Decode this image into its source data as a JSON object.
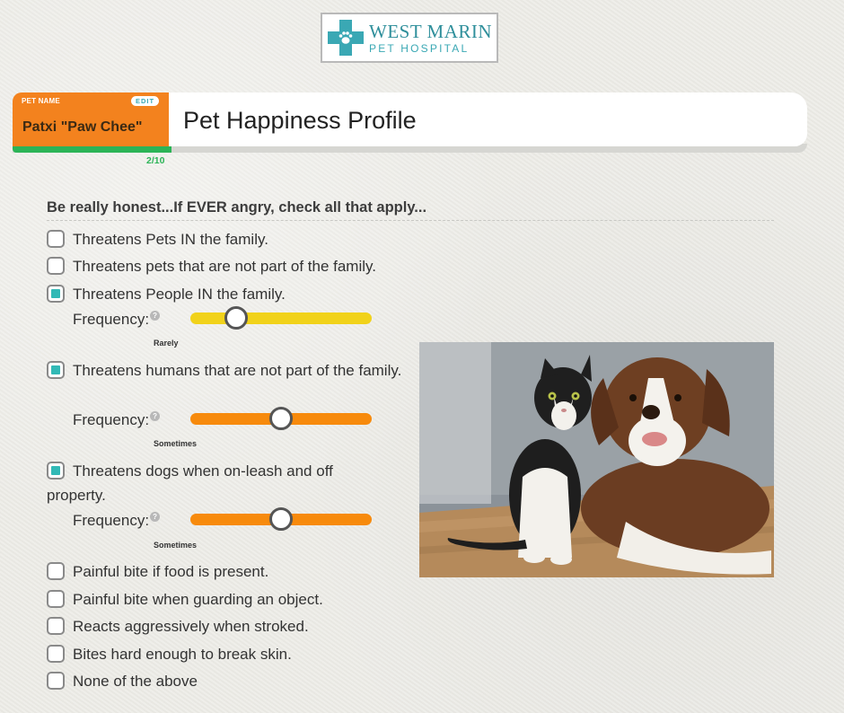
{
  "logo": {
    "line1": "WEST MARIN",
    "line2": "PET HOSPITAL",
    "colors": {
      "teal": "#3aa8b4"
    }
  },
  "pet": {
    "label": "PET NAME",
    "edit_label": "EDIT",
    "name": "Patxi \"Paw Chee\""
  },
  "progress": {
    "text": "2/10",
    "value": 0.2
  },
  "page_title": "Pet Happiness Profile",
  "question": "Be really honest...If EVER angry, check all that apply...",
  "options": [
    {
      "label": "Threatens Pets IN the family.",
      "checked": false
    },
    {
      "label": "Threatens pets that are not part of the family.",
      "checked": false
    },
    {
      "label": "Threatens People IN the family.",
      "checked": true,
      "frequency": {
        "label": "Frequency:",
        "value": "Rarely",
        "level": 0.25
      }
    },
    {
      "label": "Threatens humans that are not part of the family.",
      "checked": true,
      "frequency": {
        "label": "Frequency:",
        "value": "Sometimes",
        "level": 0.5
      }
    },
    {
      "label": "Threatens dogs when on-leash and off property.",
      "checked": true,
      "frequency": {
        "label": "Frequency:",
        "value": "Sometimes",
        "level": 0.5
      }
    },
    {
      "label": "Painful bite if food is present.",
      "checked": false
    },
    {
      "label": "Painful bite when guarding an object.",
      "checked": false
    },
    {
      "label": "Reacts aggressively when stroked.",
      "checked": false
    },
    {
      "label": "Bites hard enough to break skin.",
      "checked": false
    },
    {
      "label": "None of the above",
      "checked": false
    }
  ],
  "colors": {
    "accent_orange": "#f3821e",
    "progress_green": "#2cb457",
    "checkbox_teal": "#31b9b6",
    "slider_rarely": "#f1d21a",
    "slider_sometimes": "#f78a0c"
  },
  "icons": [
    "paw-icon",
    "help-icon"
  ]
}
